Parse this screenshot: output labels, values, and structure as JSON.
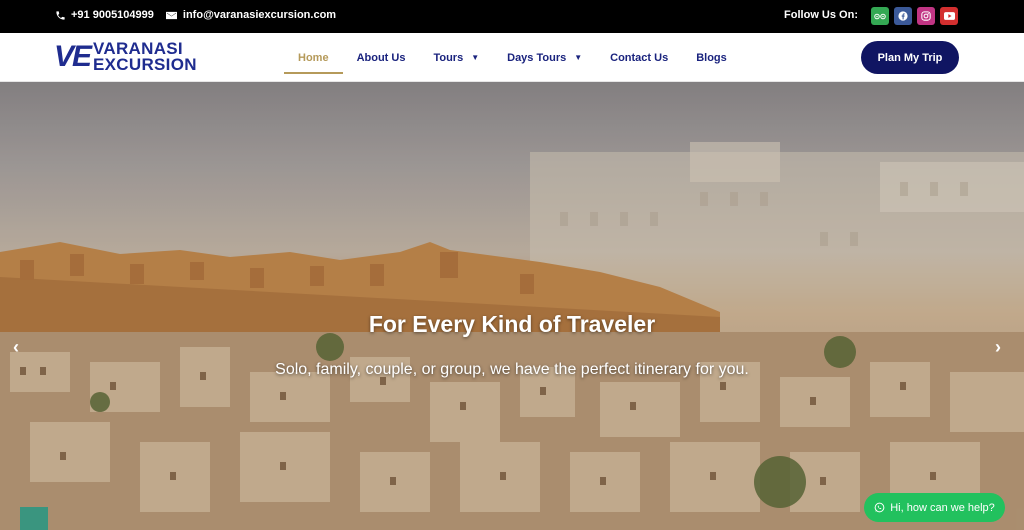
{
  "topbar": {
    "phone": "+91 9005104999",
    "email": "info@varanasiexcursion.com",
    "follow_label": "Follow Us On:",
    "socials": [
      {
        "name": "tripadvisor-icon"
      },
      {
        "name": "facebook-icon"
      },
      {
        "name": "instagram-icon"
      },
      {
        "name": "youtube-icon"
      }
    ]
  },
  "brand": {
    "mark": "VE",
    "line1": "VARANASI",
    "line2": "EXCURSION"
  },
  "nav": {
    "items": [
      {
        "label": "Home",
        "active": true
      },
      {
        "label": "About Us"
      },
      {
        "label": "Tours",
        "dropdown": true
      },
      {
        "label": "Days Tours",
        "dropdown": true
      },
      {
        "label": "Contact Us"
      },
      {
        "label": "Blogs"
      }
    ],
    "cta": "Plan My Trip"
  },
  "hero": {
    "title": "For Every Kind of Traveler",
    "subtitle": "Solo, family, couple, or group, we have the perfect itinerary for you."
  },
  "chat": {
    "label": "Hi, how can we help?"
  },
  "colors": {
    "brand_navy": "#1f2c8f",
    "cta_bg": "#101562",
    "active_gold": "#b59a5a",
    "whatsapp_green": "#22c15e"
  }
}
